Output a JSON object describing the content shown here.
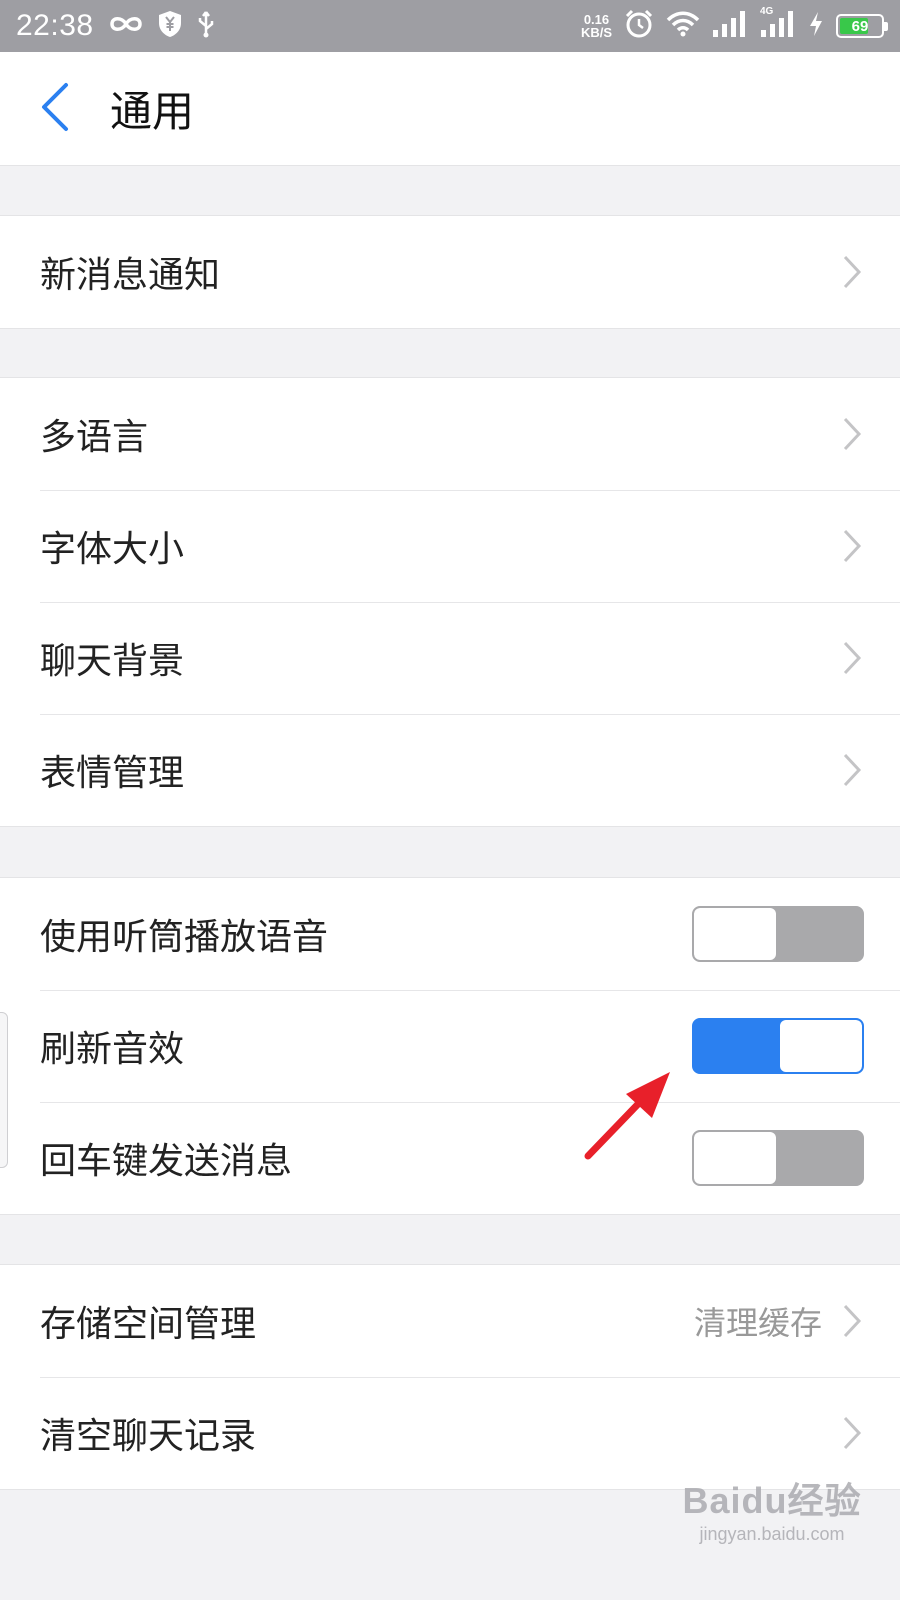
{
  "status_bar": {
    "time": "22:38",
    "net_speed_value": "0.16",
    "net_speed_unit": "KB/S",
    "network_type": "4G",
    "battery_level": "69",
    "battery_color": "#39c84a",
    "icons": [
      "infinity-icon",
      "shield-yen-icon",
      "usb-icon",
      "alarm-icon",
      "wifi-icon",
      "signal-icon",
      "signal-4g-icon",
      "charging-icon"
    ]
  },
  "header": {
    "title": "通用"
  },
  "groups": {
    "notifications": {
      "items": [
        {
          "label": "新消息通知"
        }
      ]
    },
    "display": {
      "items": [
        {
          "label": "多语言"
        },
        {
          "label": "字体大小"
        },
        {
          "label": "聊天背景"
        },
        {
          "label": "表情管理"
        }
      ]
    },
    "toggles": {
      "items": [
        {
          "label": "使用听筒播放语音",
          "on": false
        },
        {
          "label": "刷新音效",
          "on": true
        },
        {
          "label": "回车键发送消息",
          "on": false
        }
      ]
    },
    "storage": {
      "items": [
        {
          "label": "存储空间管理",
          "value": "清理缓存"
        },
        {
          "label": "清空聊天记录"
        }
      ]
    }
  },
  "colors": {
    "accent": "#2b80f0",
    "toggle_off": "#a9a9ab",
    "annotation": "#e8202a",
    "status_bar": "#9e9ea3"
  },
  "watermark": {
    "logo": "Baidu经验",
    "url": "jingyan.baidu.com"
  }
}
